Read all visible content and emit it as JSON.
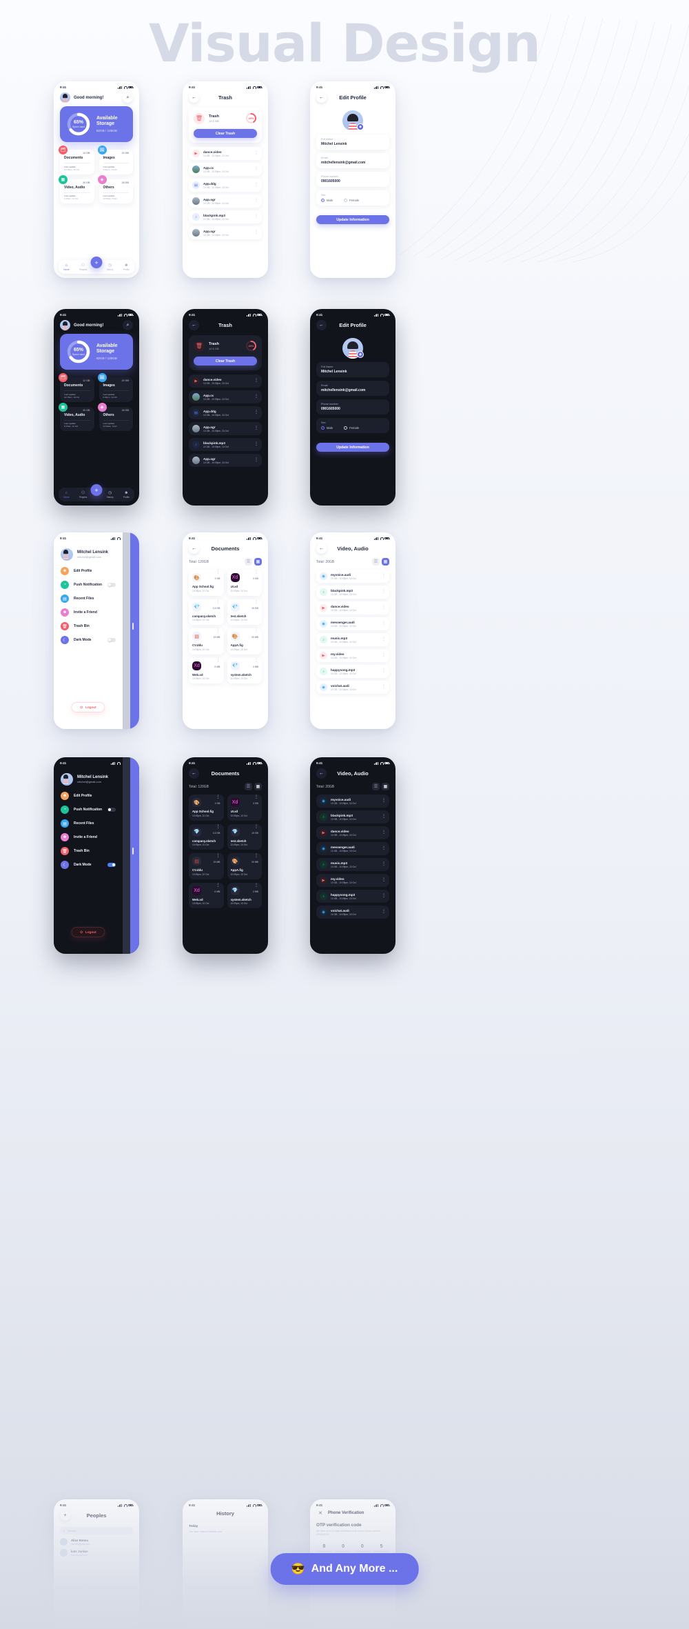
{
  "hero": {
    "title": "Visual Design"
  },
  "status": {
    "time": "9:41"
  },
  "home": {
    "greeting": "Good morning!",
    "search_icon": "search-icon",
    "storage": {
      "percent_label": "65%",
      "percent_value": 65,
      "sub": "Space used",
      "title_line1": "Available",
      "title_line2": "Storage",
      "usage": "82GB / 128GB"
    },
    "categories": [
      {
        "name": "Documents",
        "size": "12 GB",
        "update_label": "Last update",
        "update_time": "10:15am, 10 Oct",
        "color": "#f2606a",
        "icon": "document-icon"
      },
      {
        "name": "Images",
        "size": "20 GB",
        "update_label": "Last update",
        "update_time": "6:30pm, 13 Oct",
        "color": "#3aa6f0",
        "icon": "image-icon"
      },
      {
        "name": "Video, Audio",
        "size": "20 GB",
        "update_label": "Last update",
        "update_time": "9:15am, 11 Oct",
        "color": "#1fc39b",
        "icon": "video-icon"
      },
      {
        "name": "Others",
        "size": "28 GB",
        "update_label": "Last update",
        "update_time": "12:00am, 6 Apr",
        "color": "#e87fd0",
        "icon": "folder-icon"
      }
    ],
    "nav": [
      {
        "label": "Home",
        "icon": "home-icon",
        "active": true
      },
      {
        "label": "Peoples",
        "icon": "people-icon",
        "active": false
      },
      {
        "label": "History",
        "icon": "history-icon",
        "active": false
      },
      {
        "label": "Profile",
        "icon": "profile-icon",
        "active": false
      }
    ],
    "fab_icon": "plus-icon"
  },
  "trash": {
    "title": "Trash",
    "back_icon": "back-arrow-icon",
    "card": {
      "name": "Trash",
      "size": "12.5 GB",
      "percent_label": "40%",
      "percent_value": 40,
      "icon": "trash-icon"
    },
    "clear_button": "Clear Trash",
    "files": [
      {
        "name": "dance.video",
        "meta": "10 GB - 10:09pm, 10 Oct",
        "icon": "play-icon",
        "color": "#f2606a",
        "bg": "#fdecee"
      },
      {
        "name": "App.cc",
        "meta": "10 GB - 10:09pm, 10 Oct",
        "icon": "photo-icon",
        "color": "#3aa6f0",
        "bg": "#7ea7c8"
      },
      {
        "name": "App.ddg",
        "meta": "10 GB - 10:09pm, 10 Oct",
        "icon": "doc-icon",
        "color": "#4f7df3",
        "bg": "#e8eefd"
      },
      {
        "name": "App.ogr",
        "meta": "10 GB - 10:09pm, 10 Oct",
        "icon": "photo-icon",
        "color": "#7a8fa5",
        "bg": "#9fb6c9"
      },
      {
        "name": "blackpink.mp3",
        "meta": "10 GB - 10:09pm, 10 Oct",
        "icon": "music-icon",
        "color": "#4f7df3",
        "bg": "#e8eefd"
      },
      {
        "name": "App.ogr",
        "meta": "10 GB - 10:09pm, 10 Oct",
        "icon": "photo-icon",
        "color": "#7a8fa5",
        "bg": "#9fb6c9"
      }
    ]
  },
  "profile": {
    "title": "Edit Profile",
    "back_icon": "back-arrow-icon",
    "camera_icon": "camera-icon",
    "fields": [
      {
        "label": "Full Name",
        "value": "Mitchel Lensink"
      },
      {
        "label": "Email",
        "value": "mitchellensink@gmail.com"
      },
      {
        "label": "Phone number",
        "value": "0901605000"
      }
    ],
    "sex_label": "Sex",
    "sex_options": [
      {
        "label": "Male",
        "selected": true
      },
      {
        "label": "Female",
        "selected": false
      }
    ],
    "update_button": "Update Information"
  },
  "drawer": {
    "user_name": "Mitchel Lensink",
    "user_email": "mitchel@gmail.com",
    "items": [
      {
        "label": "Edit Profile",
        "icon": "user-icon",
        "color": "#f5a45e",
        "toggle": null
      },
      {
        "label": "Push Notification",
        "icon": "bell-icon",
        "color": "#1fc39b",
        "toggle": false
      },
      {
        "label": "Recent Files",
        "icon": "files-icon",
        "color": "#3aa6f0",
        "toggle": null
      },
      {
        "label": "Invite a Friend",
        "icon": "invite-icon",
        "color": "#e87fd0",
        "toggle": null
      },
      {
        "label": "Trash Bin",
        "icon": "trash-icon",
        "color": "#f2606a",
        "toggle": null
      },
      {
        "label": "Dark Mode",
        "icon": "moon-icon",
        "color": "#6c72e8",
        "toggle": false
      }
    ],
    "dark_items_toggle": {
      "push": false,
      "dark": true
    },
    "logout": "Logout",
    "logout_icon": "logout-icon"
  },
  "documents": {
    "title": "Documents",
    "back_icon": "back-arrow-icon",
    "total": "Total: 120GB",
    "view_list_icon": "list-view-icon",
    "view_grid_icon": "grid-view-icon",
    "files": [
      {
        "name": "App School.fig",
        "size": "2 GB",
        "date": "10:09pm, 10 Oct",
        "icon": "figma-icon"
      },
      {
        "name": "UI.xd",
        "size": "3 GB",
        "date": "10:09pm, 10 Oct",
        "icon": "xd-icon"
      },
      {
        "name": "company.sketch",
        "size": "3.3 GB",
        "date": "10:09pm, 10 Oct",
        "icon": "sketch-icon"
      },
      {
        "name": "test.sketch",
        "size": "10 GB",
        "date": "10:09pm, 10 Oct",
        "icon": "sketch-icon"
      },
      {
        "name": "CV.ddu",
        "size": "15 MB",
        "date": "10:09pm, 10 Oct",
        "icon": "pdf-icon"
      },
      {
        "name": "AppA.fig",
        "size": "20 MB",
        "date": "10:09pm, 10 Oct",
        "icon": "figma-icon"
      },
      {
        "name": "Web.xd",
        "size": "6 MB",
        "date": "10:09pm, 10 Oct",
        "icon": "xd-icon"
      },
      {
        "name": "system.sketch",
        "size": "3 MB",
        "date": "10:09pm, 10 Oct",
        "icon": "sketch-icon"
      }
    ]
  },
  "video_audio": {
    "title": "Video, Audio",
    "back_icon": "back-arrow-icon",
    "total": "Total: 20GB",
    "view_list_icon": "list-view-icon",
    "view_grid_icon": "grid-view-icon",
    "files": [
      {
        "name": "myvoice.audi",
        "meta": "10 GB - 10:09pm, 10 Oct",
        "icon": "mic-icon",
        "color": "#3aa6f0",
        "bg": "#e6f2fd"
      },
      {
        "name": "blackpink.mp3",
        "meta": "10 GB - 10:09pm, 10 Oct",
        "icon": "music-icon",
        "color": "#1fc39b",
        "bg": "#e4f8f2"
      },
      {
        "name": "dance.video",
        "meta": "10 GB - 10:09pm, 10 Oct",
        "icon": "play-icon",
        "color": "#f2606a",
        "bg": "#fdecee"
      },
      {
        "name": "messenger.audi",
        "meta": "10 GB - 10:09pm, 10 Oct",
        "icon": "mic-icon",
        "color": "#3aa6f0",
        "bg": "#e6f2fd"
      },
      {
        "name": "music.mp3",
        "meta": "10 GB - 10:09pm, 10 Oct",
        "icon": "music-icon",
        "color": "#1fc39b",
        "bg": "#e4f8f2"
      },
      {
        "name": "my.video",
        "meta": "10 GB - 10:09pm, 10 Oct",
        "icon": "play-icon",
        "color": "#f2606a",
        "bg": "#fdecee"
      },
      {
        "name": "happysong.mp3",
        "meta": "10 GB - 10:09pm, 10 Oct",
        "icon": "music-icon",
        "color": "#1fc39b",
        "bg": "#e4f8f2"
      },
      {
        "name": "voichat.audi",
        "meta": "10 GB - 10:09pm, 10 Oct",
        "icon": "mic-icon",
        "color": "#3aa6f0",
        "bg": "#e6f2fd"
      }
    ]
  },
  "teaser": {
    "cta_label": "And Any More ...",
    "cta_emoji": "😎",
    "peoples": {
      "title": "Peoples",
      "add_icon": "plus-icon",
      "search_placeholder": "Search...",
      "rows": [
        {
          "name": "Alice Emma",
          "meta": "mitchel@gmail.com"
        },
        {
          "name": "kate Jordan",
          "meta": "kate@gmail.com"
        }
      ]
    },
    "history": {
      "title": "History",
      "section": "Today",
      "rows": [
        "You have visited Dribbble.com"
      ]
    },
    "verification": {
      "title": "Phone Verification",
      "close_icon": "close-icon",
      "heading": "OTP verification code",
      "desc": "We have sent a 4 digit verification code to your phone number 0900000000",
      "digits": [
        "8",
        "0",
        "0",
        "5"
      ]
    }
  },
  "colors": {
    "accent": "#6c72e8",
    "danger": "#f2606a",
    "success": "#1fc39b",
    "info": "#3aa6f0"
  }
}
